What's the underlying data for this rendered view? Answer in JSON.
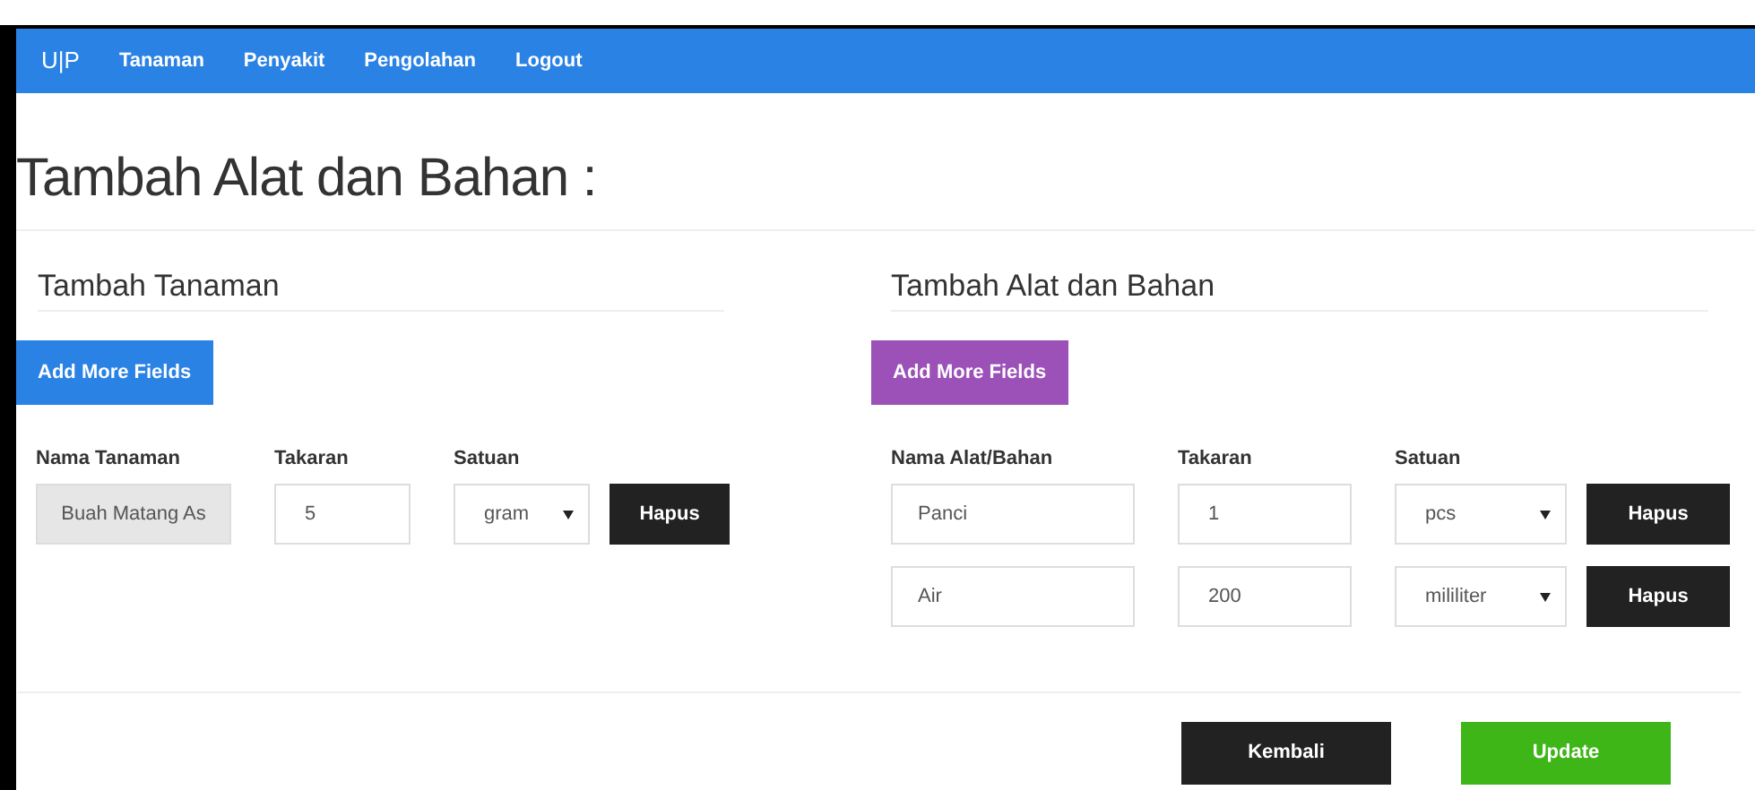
{
  "navbar": {
    "brand": "U|P",
    "links": [
      "Tanaman",
      "Penyakit",
      "Pengolahan",
      "Logout"
    ]
  },
  "title": "Tambah Alat dan Bahan :",
  "sections": [
    {
      "heading": "Tambah Tanaman",
      "add_button": "Add More Fields",
      "color": "#2a82e4",
      "columns": [
        "Nama Tanaman",
        "Takaran",
        "Satuan"
      ],
      "rows": [
        {
          "name": "Buah Matang As",
          "disabled": true,
          "amount": "5",
          "unit": "gram",
          "remove": "Hapus"
        }
      ]
    },
    {
      "heading": "Tambah Alat dan Bahan",
      "add_button": "Add More Fields",
      "color": "#9b51b8",
      "columns": [
        "Nama Alat/Bahan",
        "Takaran",
        "Satuan"
      ],
      "rows": [
        {
          "name": "Panci",
          "disabled": false,
          "amount": "1",
          "unit": "pcs",
          "remove": "Hapus"
        },
        {
          "name": "Air",
          "disabled": false,
          "amount": "200",
          "unit": "mililiter",
          "remove": "Hapus"
        }
      ]
    }
  ],
  "footer_buttons": [
    {
      "label": "Kembali",
      "color": "#222222"
    },
    {
      "label": "Update",
      "color": "#3fb618"
    }
  ]
}
